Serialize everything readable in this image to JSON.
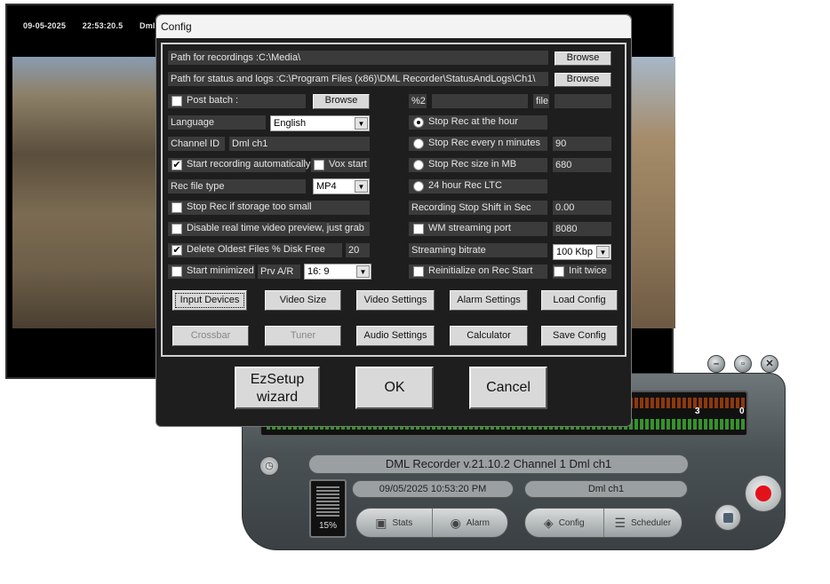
{
  "video": {
    "date": "09-05-2025",
    "time": "22:53:20.5",
    "channel_partial": "Dml ch"
  },
  "recorder": {
    "title": "DML Recorder v.21.10.2 Channel 1 Dml ch1",
    "datetime": "09/05/2025 10:53:20 PM",
    "channel": "Dml ch1",
    "disk_percent": "15%",
    "meter_left": "3",
    "meter_right": "0",
    "stats_label": "Stats",
    "alarm_label": "Alarm",
    "config_label": "Config",
    "scheduler_label": "Scheduler"
  },
  "config": {
    "title": "Config",
    "path_recordings": "Path for recordings :C:\\Media\\",
    "path_status": "Path for status and logs :C:\\Program Files (x86)\\DML Recorder\\StatusAndLogs\\Ch1\\",
    "browse_label": "Browse",
    "post_batch_label": "Post batch :",
    "post_batch_value": "",
    "percent2_label": "%2",
    "file_label": "file",
    "language_label": "Language",
    "language_value": "English",
    "channel_id_label": "Channel ID",
    "channel_id_value": "Dml ch1",
    "start_recording_label": "Start recording automatically",
    "vox_start_label": "Vox start",
    "rec_file_type_label": "Rec file type",
    "rec_file_type_value": "MP4",
    "stop_rec_storage_label": "Stop Rec if storage too small",
    "disable_preview_label": "Disable real time video preview, just grab",
    "delete_oldest_label": "Delete Oldest Files % Disk Free",
    "delete_oldest_value": "20",
    "start_minimized_label": "Start minimized",
    "prv_ar_label": "Prv A/R",
    "prv_ar_value": "16: 9",
    "stop_rec_hour_label": "Stop Rec at the hour",
    "stop_rec_every_label": "Stop Rec every n minutes",
    "stop_rec_every_value": "90",
    "stop_rec_size_label": "Stop Rec size in MB",
    "stop_rec_size_value": "680",
    "rec_ltc_label": "24 hour Rec LTC",
    "stop_shift_label": "Recording Stop Shift in Sec",
    "stop_shift_value": "0.00",
    "wm_streaming_label": "WM streaming port",
    "wm_streaming_value": "8080",
    "streaming_bitrate_label": "Streaming bitrate",
    "streaming_bitrate_value": "100 Kbp",
    "reinit_label": "Reinitialize on Rec Start",
    "init_twice_label": "Init twice",
    "buttons_row1": [
      "Input Devices",
      "Video Size",
      "Video Settings",
      "Alarm Settings",
      "Load Config"
    ],
    "buttons_row2": [
      "Crossbar",
      "Tuner",
      "Audio Settings",
      "Calculator",
      "Save Config"
    ],
    "ezsetup_line1": "EzSetup",
    "ezsetup_line2": "wizard",
    "ok_label": "OK",
    "cancel_label": "Cancel",
    "checks": {
      "post_batch": false,
      "start_recording": true,
      "vox_start": false,
      "stop_rec_storage": false,
      "disable_preview": false,
      "delete_oldest": true,
      "start_minimized": false,
      "wm_streaming": false,
      "reinit": false,
      "init_twice": false
    },
    "stop_mode_selected": "Stop Rec at the hour"
  }
}
